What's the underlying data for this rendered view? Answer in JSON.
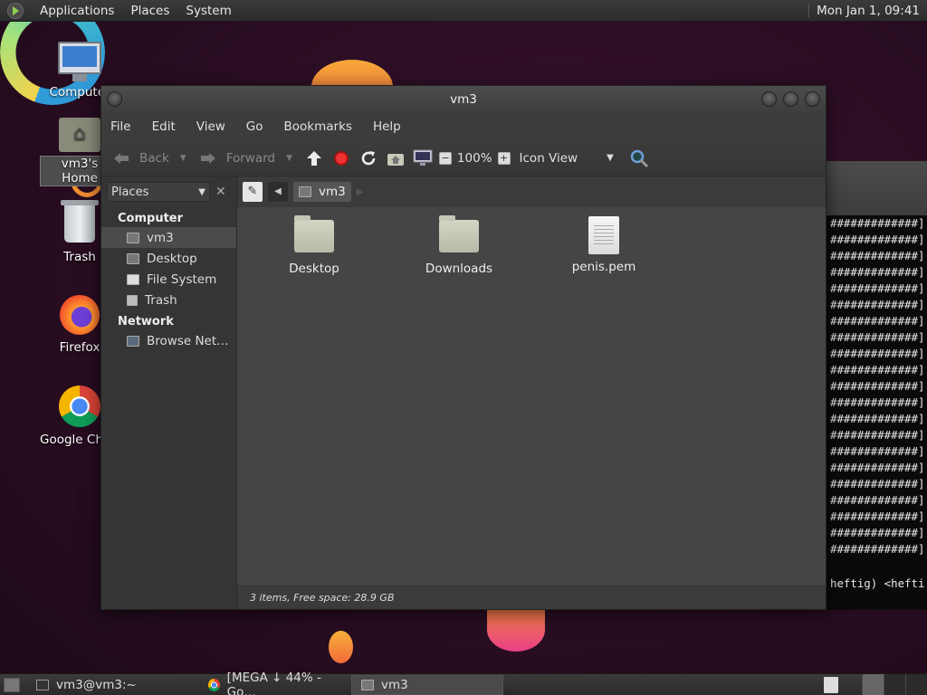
{
  "top_panel": {
    "menus": [
      "Applications",
      "Places",
      "System"
    ],
    "clock": "Mon Jan 1, 09:41"
  },
  "desktop_icons": [
    {
      "label": "Computer",
      "icon": "computer-icon"
    },
    {
      "label": "vm3's Home",
      "icon": "home-folder-icon"
    },
    {
      "label": "Trash",
      "icon": "trash-icon"
    },
    {
      "label": "Firefox",
      "icon": "firefox-icon"
    },
    {
      "label": "Google Chrome",
      "icon": "chrome-icon"
    }
  ],
  "file_manager": {
    "title": "vm3",
    "menubar": [
      "File",
      "Edit",
      "View",
      "Go",
      "Bookmarks",
      "Help"
    ],
    "toolbar": {
      "back_label": "Back",
      "forward_label": "Forward",
      "zoom": "100%",
      "view_mode": "Icon View"
    },
    "sidebar": {
      "selector": "Places",
      "sections": [
        {
          "title": "Computer",
          "items": [
            {
              "label": "vm3",
              "icon": "home-icon",
              "selected": true
            },
            {
              "label": "Desktop",
              "icon": "desktop-icon",
              "selected": false
            },
            {
              "label": "File System",
              "icon": "drive-icon",
              "selected": false
            },
            {
              "label": "Trash",
              "icon": "trash-icon",
              "selected": false
            }
          ]
        },
        {
          "title": "Network",
          "items": [
            {
              "label": "Browse Net…",
              "icon": "network-icon",
              "selected": false
            }
          ]
        }
      ]
    },
    "path": {
      "current": "vm3"
    },
    "files": [
      {
        "name": "Desktop",
        "type": "folder"
      },
      {
        "name": "Downloads",
        "type": "folder"
      },
      {
        "name": "penis.pem",
        "type": "file"
      }
    ],
    "status": "3 items, Free space: 28.9 GB"
  },
  "terminal": {
    "hash_line": "#############]",
    "hash_lines_count": 21,
    "prompt": "heftig) <hefti"
  },
  "bottom_panel": {
    "tasks": [
      {
        "label": "vm3@vm3:~",
        "icon": "terminal-icon",
        "active": false
      },
      {
        "label": "[MEGA ↓ 44% - Go…",
        "icon": "chrome-icon",
        "active": false
      },
      {
        "label": "vm3",
        "icon": "folder-icon",
        "active": true
      }
    ]
  }
}
